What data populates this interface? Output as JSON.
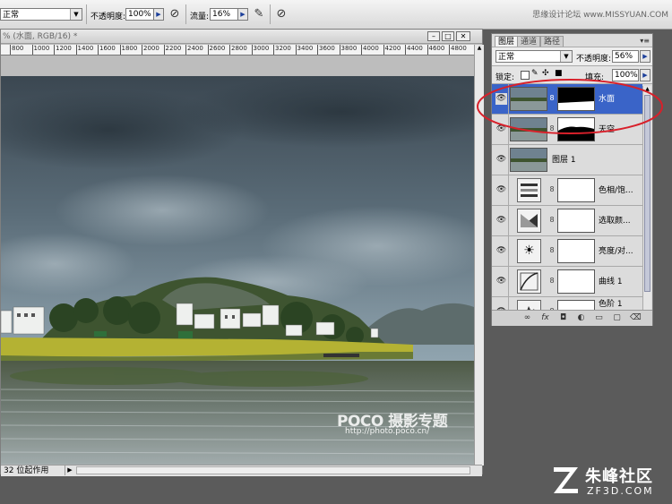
{
  "options": {
    "mode": "正常",
    "opacity_label": "不透明度:",
    "opacity_value": "100%",
    "flow_label": "流量:",
    "flow_value": "16%",
    "watermark": "思缘设计论坛 www.MISSYUAN.COM"
  },
  "document": {
    "title": "% (水面, RGB/16) *",
    "ruler_ticks": [
      "800",
      "1000",
      "1200",
      "1400",
      "1600",
      "1800",
      "2000",
      "2200",
      "2400",
      "2600",
      "2800",
      "3000",
      "3200",
      "3400",
      "3600",
      "3800",
      "4000",
      "4200",
      "4400",
      "4600",
      "4800"
    ],
    "status": "32 位起作用",
    "photo_watermark_brand": "POCO 摄影专题",
    "photo_watermark_url": "http://photo.poco.cn/"
  },
  "panel": {
    "tabs": [
      "图层",
      "通道",
      "路径"
    ],
    "blend_mode": "正常",
    "opacity_label": "不透明度:",
    "opacity_value": "56%",
    "lock_label": "锁定:",
    "fill_label": "填充:",
    "fill_value": "100%",
    "layers": [
      {
        "name": "水面",
        "type": "image-mask-water",
        "selected": true
      },
      {
        "name": "天空",
        "type": "image-mask-sky",
        "selected": false
      },
      {
        "name": "图层 1",
        "type": "image",
        "selected": false
      },
      {
        "name": "色相/饱...",
        "type": "adj-hue",
        "selected": false
      },
      {
        "name": "选取颜...",
        "type": "adj-selective",
        "selected": false
      },
      {
        "name": "亮度/对...",
        "type": "adj-brightness",
        "selected": false
      },
      {
        "name": "曲线 1",
        "type": "adj-curves",
        "selected": false
      },
      {
        "name": "色阶 1",
        "type": "adj-levels",
        "selected": false
      }
    ],
    "highlight_color": "#3a64c8",
    "annotation_color": "#d8202a"
  },
  "logo": {
    "brand": "朱峰社区",
    "domain": "ZF3D.COM"
  }
}
